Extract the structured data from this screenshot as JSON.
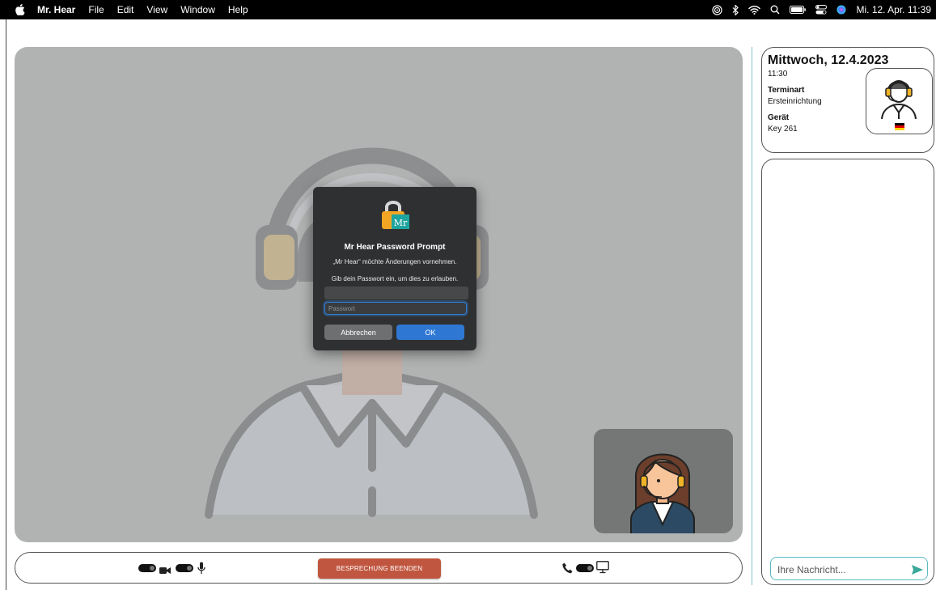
{
  "menubar": {
    "app_name": "Mr. Hear",
    "menus": [
      "File",
      "Edit",
      "View",
      "Window",
      "Help"
    ],
    "clock": "Mi. 12. Apr. 11:39"
  },
  "dialog": {
    "title": "Mr Hear Password Prompt",
    "message": "„Mr Hear“ möchte Änderungen vornehmen.",
    "instruction": "Gib dein Passwort ein, um dies zu erlauben.",
    "username_value": "",
    "password_placeholder": "Passwort",
    "cancel_label": "Abbrechen",
    "ok_label": "OK",
    "icon_text": "Mr"
  },
  "controls": {
    "end_call_label": "BESPRECHUNG BEENDEN"
  },
  "appointment": {
    "date": "Mittwoch, 12.4.2023",
    "time": "11:30",
    "type_label": "Terminart",
    "type_value": "Ersteinrichtung",
    "device_label": "Gerät",
    "device_value": "Key 261"
  },
  "chat": {
    "input_placeholder": "Ihre Nachricht..."
  },
  "colors": {
    "end_call": "#c0563f",
    "ok_button": "#2e78d3",
    "accent_teal": "#5bb9c4",
    "video_bg": "#b1b3b3"
  }
}
